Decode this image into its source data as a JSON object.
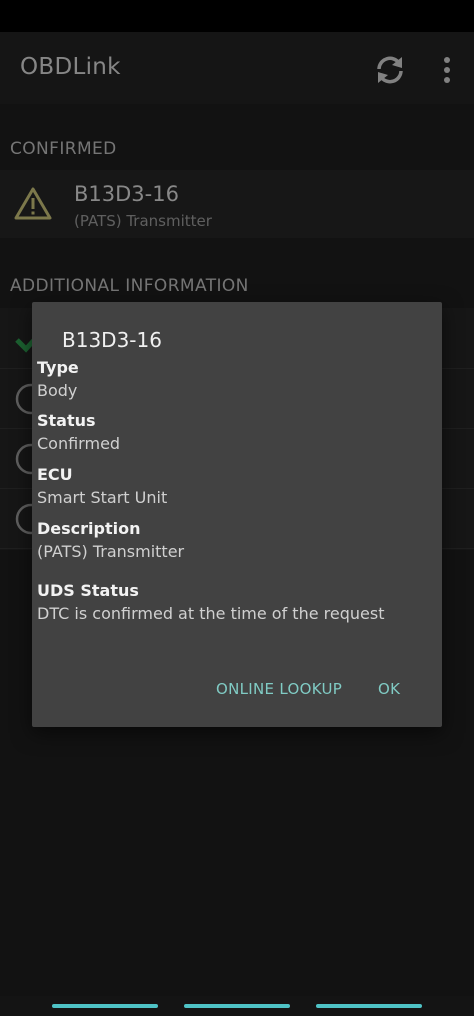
{
  "app_bar": {
    "title": "OBDLink",
    "refresh_icon": "refresh-icon",
    "menu_icon": "more-vert-icon"
  },
  "sections": {
    "confirmed": "CONFIRMED",
    "additional": "ADDITIONAL INFORMATION"
  },
  "dtc": {
    "code": "B13D3-16",
    "description": "(PATS) Transmitter",
    "icon": "warning-icon"
  },
  "dialog": {
    "title": "B13D3-16",
    "fields": [
      {
        "label": "Type",
        "value": "Body"
      },
      {
        "label": "Status",
        "value": "Confirmed"
      },
      {
        "label": "ECU",
        "value": "Smart Start Unit"
      },
      {
        "label": "Description",
        "value": "(PATS) Transmitter"
      },
      {
        "label": "UDS Status",
        "value": "DTC is confirmed at the time of the request"
      }
    ],
    "online_lookup_label": "ONLINE LOOKUP",
    "ok_label": "OK"
  },
  "colors": {
    "accent": "#80cbc4",
    "warning": "#c8c27a",
    "check": "#2e9e4f",
    "nav": "#4fc3c6"
  }
}
